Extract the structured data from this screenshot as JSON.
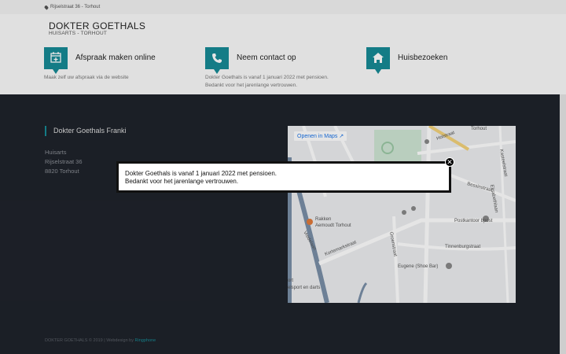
{
  "topbar": {
    "address": "Rijselstraat 36 - Torhout",
    "icon": "map-pin-icon"
  },
  "brand": {
    "title": "DOKTER GOETHALS",
    "subtitle": "HUISARTS - TORHOUT"
  },
  "features": [
    {
      "title": "Afspraak maken online",
      "desc_lines": [
        "Maak zelf uw afspraak via de website"
      ],
      "icon": "calendar-plus-icon"
    },
    {
      "title": "Neem contact op",
      "desc_lines": [
        "Dokter Goethals is vanaf 1 januari 2022 met pensioen.",
        "Bedankt voor het jarenlange vertrouwen."
      ],
      "icon": "phone-icon"
    },
    {
      "title": "Huisbezoeken",
      "desc_lines": [],
      "icon": "home-icon"
    }
  ],
  "footer": {
    "name": "Dokter Goethals Franki",
    "address_lines": [
      "Huisarts",
      "Rijselstraat 36",
      "8820 Torhout"
    ],
    "copyright": "DOKTER GOETHALS © 2019 | Webdesign by",
    "credit_link": "Ringphone"
  },
  "map": {
    "open_label": "Openen in Maps",
    "labels": [
      "Holstraat",
      "Torhout",
      "Kasteelstraat",
      "Bessinstraat",
      "Elisabethlaan",
      "Postkantoor bpost",
      "Rakken",
      "Aemoudt Torhout",
      "Kortemarkstraat",
      "Groenstraat",
      "Tinnenburgstraat",
      "Eugene (Shoe Bar)",
      "Vredelaan",
      "ort",
      "elsport en darts"
    ]
  },
  "modal": {
    "lines": [
      "Dokter Goethals is vanaf 1 januari 2022 met pensioen.",
      "Bedankt voor het jarenlange vertrouwen."
    ],
    "close_glyph": "✕"
  },
  "colors": {
    "accent": "#178b96",
    "footer_bg": "#1f232b"
  }
}
